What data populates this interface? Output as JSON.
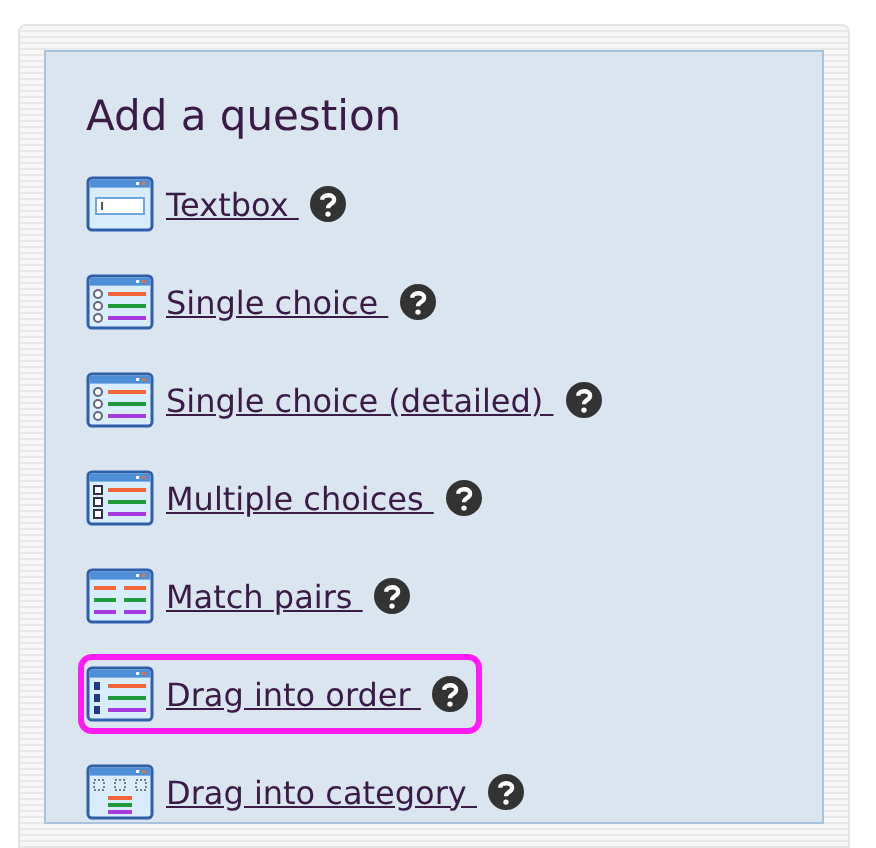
{
  "heading": "Add a question",
  "items": [
    {
      "label": "Textbox",
      "kind": "textbox",
      "selected": false
    },
    {
      "label": "Single choice",
      "kind": "radio",
      "selected": false
    },
    {
      "label": "Single choice (detailed)",
      "kind": "radio",
      "selected": false
    },
    {
      "label": "Multiple choices",
      "kind": "checkbox",
      "selected": false
    },
    {
      "label": "Match pairs",
      "kind": "pairs",
      "selected": false
    },
    {
      "label": "Drag into order",
      "kind": "order",
      "selected": true
    },
    {
      "label": "Drag into category",
      "kind": "category",
      "selected": false
    }
  ]
}
